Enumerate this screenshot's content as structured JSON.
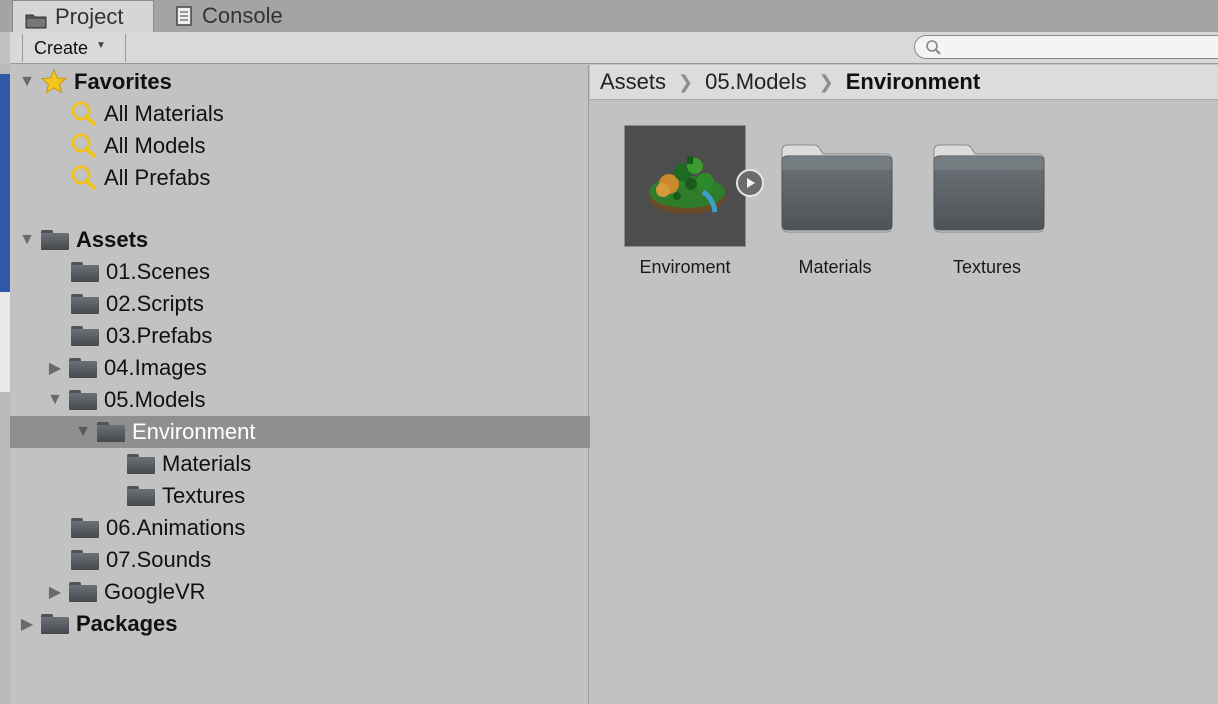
{
  "tabs": [
    {
      "label": "Project",
      "icon": "folder-icon",
      "active": true
    },
    {
      "label": "Console",
      "icon": "console-icon",
      "active": false
    }
  ],
  "toolbar": {
    "create_label": "Create",
    "search_value": "",
    "search_placeholder": ""
  },
  "tree": {
    "favorites": {
      "label": "Favorites",
      "items": [
        "All Materials",
        "All Models",
        "All Prefabs"
      ]
    },
    "assets": {
      "label": "Assets",
      "items": [
        {
          "label": "01.Scenes"
        },
        {
          "label": "02.Scripts"
        },
        {
          "label": "03.Prefabs"
        },
        {
          "label": "04.Images",
          "collapsed": true
        },
        {
          "label": "05.Models",
          "expanded": true
        },
        {
          "label": "Environment",
          "expanded": true,
          "selected": true
        },
        {
          "label": "Materials"
        },
        {
          "label": "Textures"
        },
        {
          "label": "06.Animations"
        },
        {
          "label": "07.Sounds"
        },
        {
          "label": "GoogleVR",
          "collapsed": true
        }
      ]
    },
    "packages": {
      "label": "Packages"
    }
  },
  "breadcrumb": [
    "Assets",
    "05.Models",
    "Environment"
  ],
  "content_items": [
    {
      "label": "Enviroment",
      "kind": "model-prefab"
    },
    {
      "label": "Materials",
      "kind": "folder"
    },
    {
      "label": "Textures",
      "kind": "folder"
    }
  ],
  "colors": {
    "panel_bg": "#c2c2c2",
    "selected_row": "#8f8f8f",
    "folder": "#5b6166",
    "toolbar_bg": "#d9d9d9"
  }
}
